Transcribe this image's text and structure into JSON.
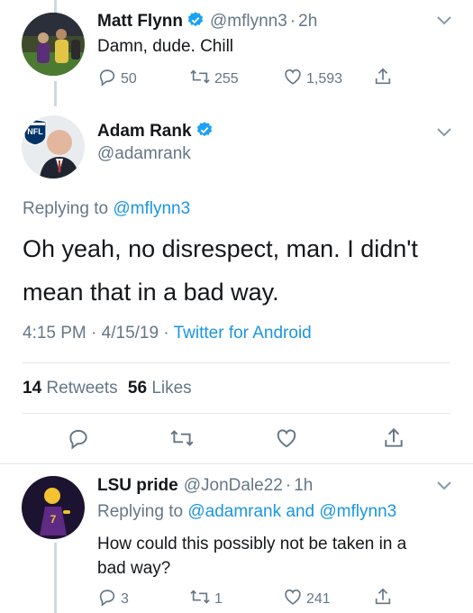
{
  "tweet1": {
    "name": "Matt Flynn",
    "handle": "@mflynn3",
    "time": "2h",
    "text": "Damn, dude. Chill",
    "replies": "50",
    "retweets": "255",
    "likes": "1,593"
  },
  "main": {
    "name": "Adam Rank",
    "handle": "@adamrank",
    "avatar_badge": "NFL",
    "replying_prefix": "Replying to",
    "replying_to": "@mflynn3",
    "text_line1": "Oh yeah, no disrespect, man. I didn't",
    "text_line2": "mean that in a bad way.",
    "time": "4:15 PM",
    "date": "4/15/19",
    "source": "Twitter for Android",
    "retweet_count": "14",
    "retweet_label": "Retweets",
    "like_count": "56",
    "like_label": "Likes"
  },
  "tweet3": {
    "name": "LSU pride",
    "handle": "@JonDale22",
    "time": "1h",
    "replying_prefix": "Replying to",
    "replying_to_1": "@adamrank",
    "replying_and": "and",
    "replying_to_2": "@mflynn3",
    "text_line1": "How could this possibly not be taken in a",
    "text_line2": "bad way?",
    "replies": "3",
    "retweets": "1",
    "likes": "241"
  },
  "separator": "·",
  "colors": {
    "text": "#14171a",
    "secondary": "#657786",
    "link": "#1b95e0",
    "verified": "#1da1f2",
    "divider": "#e1e8ed"
  }
}
